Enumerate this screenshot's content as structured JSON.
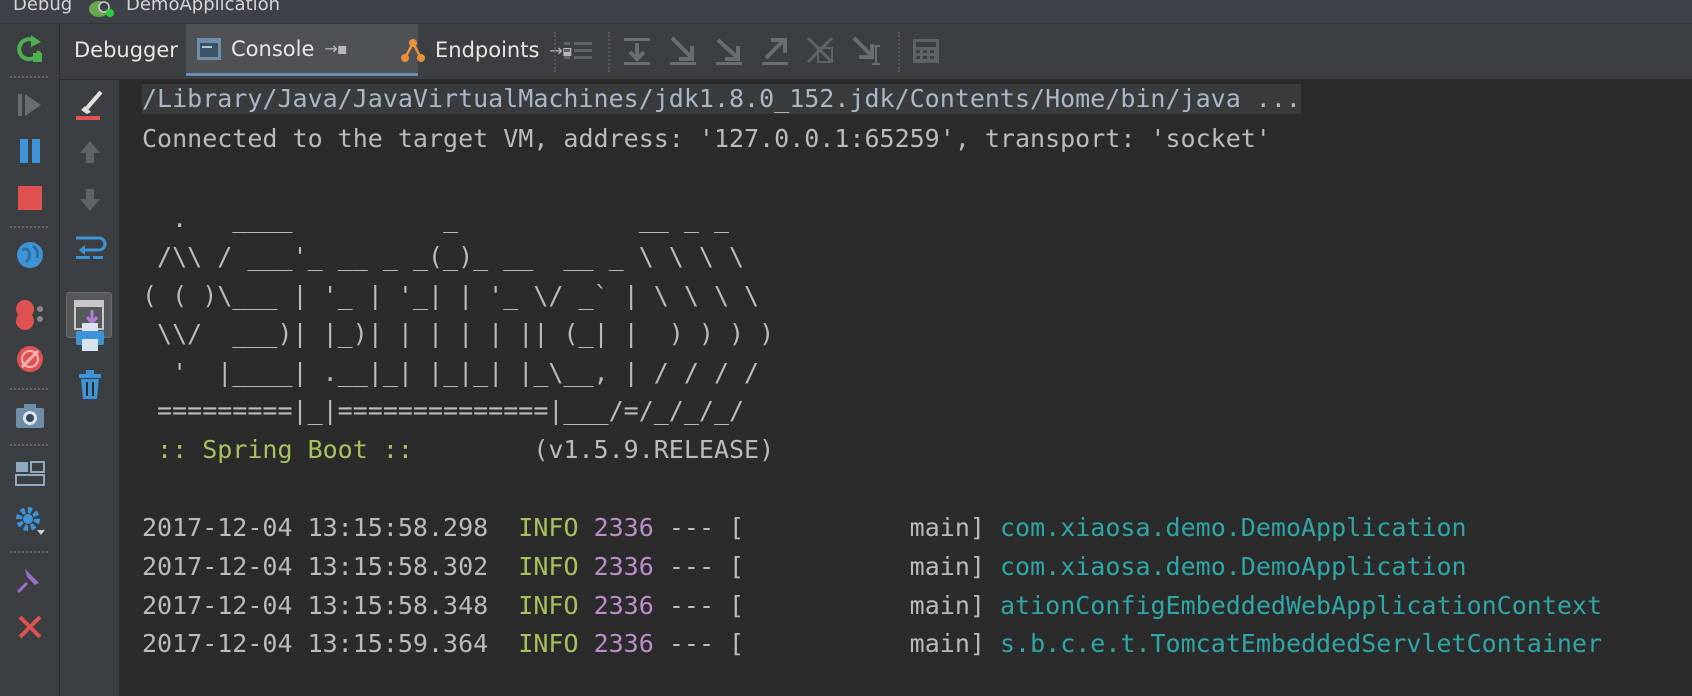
{
  "titlebar": {
    "tool": "Debug",
    "app_name": "DemoApplication"
  },
  "tabs": [
    {
      "label": "Debugger"
    },
    {
      "label": "Console",
      "pin": "→▪"
    },
    {
      "label": "Endpoints",
      "pin": "→▪"
    }
  ],
  "console": {
    "command_line": "/Library/Java/JavaVirtualMachines/jdk1.8.0_152.jdk/Contents/Home/bin/java ...",
    "connected_line": "Connected to the target VM, address: '127.0.0.1:65259', transport: 'socket'",
    "banner": [
      "  .   ____          _            __ _ _",
      " /\\\\ / ___'_ __ _ _(_)_ __  __ _ \\ \\ \\ \\",
      "( ( )\\___ | '_ | '_| | '_ \\/ _` | \\ \\ \\ \\",
      " \\\\/  ___)| |_)| | | | | || (_| |  ) ) ) )",
      "  '  |____| .__|_| |_|_| |_\\__, | / / / /",
      " =========|_|==============|___/=/_/_/_/"
    ],
    "spring_label": " :: Spring Boot :: ",
    "spring_version": "       (v1.5.9.RELEASE)",
    "log": [
      {
        "ts": "2017-12-04 13:15:58.298",
        "level": "INFO",
        "pid": "2336",
        "thread": " --- [           main] ",
        "logger": "com.xiaosa.demo.DemoApplication"
      },
      {
        "ts": "2017-12-04 13:15:58.302",
        "level": "INFO",
        "pid": "2336",
        "thread": " --- [           main] ",
        "logger": "com.xiaosa.demo.DemoApplication"
      },
      {
        "ts": "2017-12-04 13:15:58.348",
        "level": "INFO",
        "pid": "2336",
        "thread": " --- [           main] ",
        "logger": "ationConfigEmbeddedWebApplicationContext"
      },
      {
        "ts": "2017-12-04 13:15:59.364",
        "level": "INFO",
        "pid": "2336",
        "thread": " --- [           main] ",
        "logger": "s.b.c.e.t.TomcatEmbeddedServletContainer"
      }
    ]
  },
  "colors": {
    "console_bg": "#2b2b2b",
    "toolbar_bg": "#3c3f41",
    "log_level": "#a5c25c",
    "log_pid": "#b98ec9",
    "log_logger": "#2fa6a6"
  }
}
